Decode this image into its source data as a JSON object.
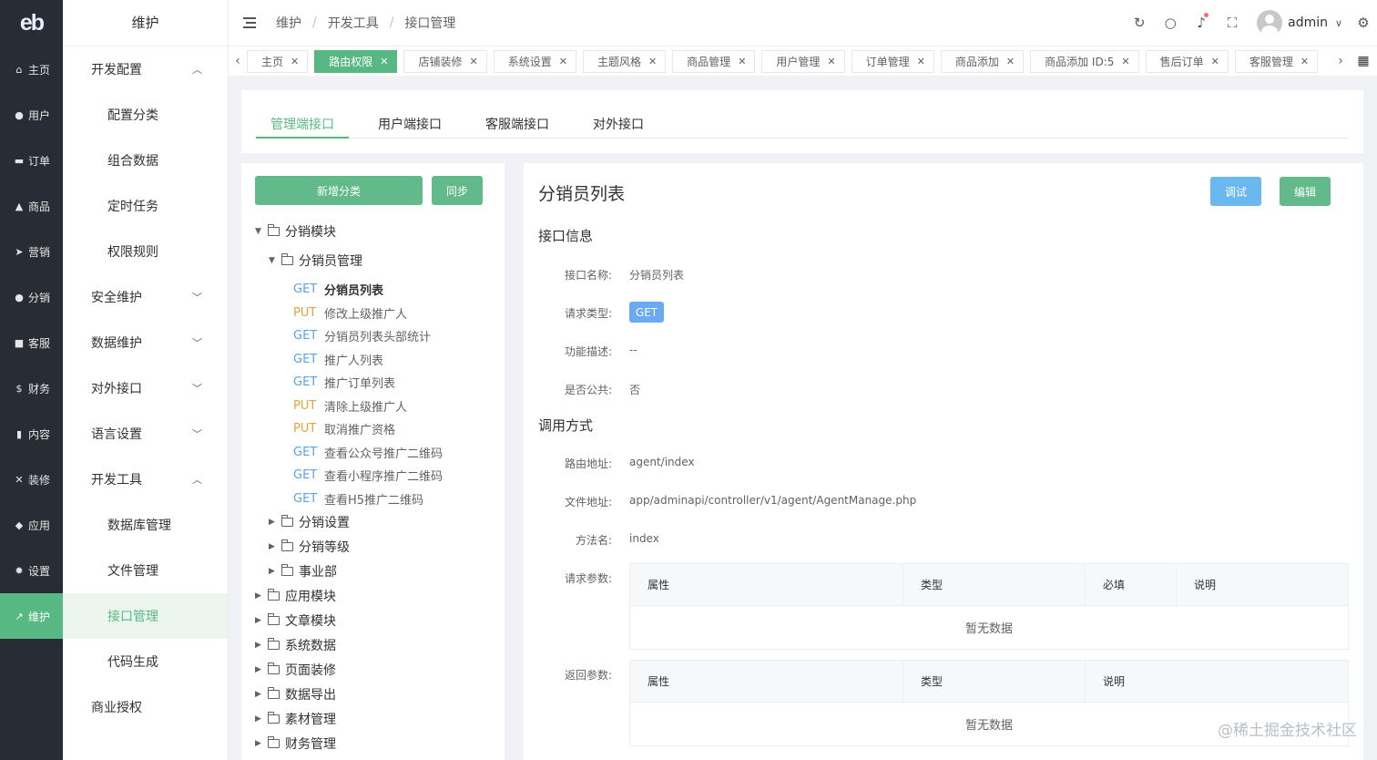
{
  "brand": {
    "logo": "eb"
  },
  "rail": [
    {
      "icon": "home-icon",
      "glyph": "⌂",
      "label": "主页"
    },
    {
      "icon": "user-icon",
      "glyph": "●",
      "label": "用户"
    },
    {
      "icon": "cart-icon",
      "glyph": "▬",
      "label": "订单"
    },
    {
      "icon": "bag-icon",
      "glyph": "▲",
      "label": "商品"
    },
    {
      "icon": "send-icon",
      "glyph": "➤",
      "label": "营销"
    },
    {
      "icon": "group-icon",
      "glyph": "●",
      "label": "分销"
    },
    {
      "icon": "chat-icon",
      "glyph": "■",
      "label": "客服"
    },
    {
      "icon": "dollar-icon",
      "glyph": "$",
      "label": "财务"
    },
    {
      "icon": "book-icon",
      "glyph": "▮",
      "label": "内容"
    },
    {
      "icon": "tools-icon",
      "glyph": "✕",
      "label": "装修"
    },
    {
      "icon": "cube-icon",
      "glyph": "◆",
      "label": "应用"
    },
    {
      "icon": "gear-icon",
      "glyph": "✹",
      "label": "设置"
    },
    {
      "icon": "wrench-icon",
      "glyph": "↗",
      "label": "维护"
    }
  ],
  "submenu": {
    "title": "维护",
    "items": [
      {
        "label": "开发配置",
        "chevron": "up"
      },
      {
        "label": "配置分类"
      },
      {
        "label": "组合数据"
      },
      {
        "label": "定时任务"
      },
      {
        "label": "权限规则"
      },
      {
        "label": "安全维护",
        "chevron": "down"
      },
      {
        "label": "数据维护",
        "chevron": "down"
      },
      {
        "label": "对外接口",
        "chevron": "down"
      },
      {
        "label": "语言设置",
        "chevron": "down"
      },
      {
        "label": "开发工具",
        "chevron": "up"
      },
      {
        "label": "数据库管理"
      },
      {
        "label": "文件管理"
      },
      {
        "label": "接口管理"
      },
      {
        "label": "代码生成"
      },
      {
        "label": "商业授权"
      }
    ]
  },
  "header": {
    "breadcrumb": [
      "维护",
      "开发工具",
      "接口管理"
    ],
    "user": "admin"
  },
  "tabs": [
    "主页",
    "路由权限",
    "店铺装修",
    "系统设置",
    "主题风格",
    "商品管理",
    "用户管理",
    "订单管理",
    "商品添加",
    "商品添加 ID:5",
    "售后订单",
    "客服管理"
  ],
  "api_tabs": [
    "管理端接口",
    "用户端接口",
    "客服端接口",
    "对外接口"
  ],
  "tree": {
    "add_button": "新增分类",
    "sync_button": "同步",
    "module": "分销模块",
    "group": "分销员管理",
    "apis": [
      {
        "method": "GET",
        "name": "分销员列表"
      },
      {
        "method": "PUT",
        "name": "修改上级推广人"
      },
      {
        "method": "GET",
        "name": "分销员列表头部统计"
      },
      {
        "method": "GET",
        "name": "推广人列表"
      },
      {
        "method": "GET",
        "name": "推广订单列表"
      },
      {
        "method": "PUT",
        "name": "清除上级推广人"
      },
      {
        "method": "PUT",
        "name": "取消推广资格"
      },
      {
        "method": "GET",
        "name": "查看公众号推广二维码"
      },
      {
        "method": "GET",
        "name": "查看小程序推广二维码"
      },
      {
        "method": "GET",
        "name": "查看H5推广二维码"
      }
    ],
    "subfolders": [
      "分销设置",
      "分销等级",
      "事业部"
    ],
    "folders": [
      "应用模块",
      "文章模块",
      "系统数据",
      "页面装修",
      "数据导出",
      "素材管理",
      "财务管理"
    ]
  },
  "detail": {
    "title": "分销员列表",
    "debug_button": "调试",
    "edit_button": "编辑",
    "info_title": "接口信息",
    "name_label": "接口名称:",
    "name_value": "分销员列表",
    "type_label": "请求类型:",
    "type_value": "GET",
    "desc_label": "功能描述:",
    "desc_value": "--",
    "public_label": "是否公共:",
    "public_value": "否",
    "call_title": "调用方式",
    "route_label": "路由地址:",
    "route_value": "agent/index",
    "file_label": "文件地址:",
    "file_value": "app/adminapi/controller/v1/agent/AgentManage.php",
    "method_label": "方法名:",
    "method_value": "index",
    "req_label": "请求参数:",
    "req_columns": [
      "属性",
      "类型",
      "必填",
      "说明"
    ],
    "resp_label": "返回参数:",
    "resp_columns": [
      "属性",
      "类型",
      "说明"
    ],
    "empty_text": "暂无数据"
  },
  "watermark": "@稀土掘金技术社区",
  "colors": {
    "accent": "#58b883",
    "get": "#5aa2e8",
    "put": "#e6a23c",
    "rail": "#282c34"
  }
}
